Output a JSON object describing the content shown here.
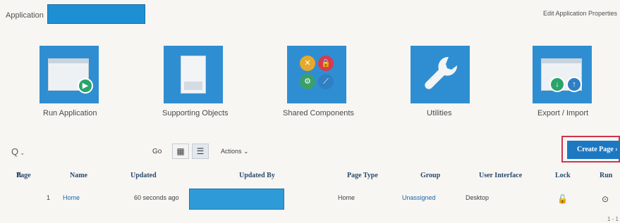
{
  "header": {
    "app_label": "Application",
    "edit_properties": "Edit Application Properties"
  },
  "tiles": [
    {
      "label": "Run Application"
    },
    {
      "label": "Supporting Objects"
    },
    {
      "label": "Shared Components"
    },
    {
      "label": "Utilities"
    },
    {
      "label": "Export / Import"
    }
  ],
  "toolbar": {
    "search_glyph": "Q",
    "go_label": "Go",
    "actions_label": "Actions",
    "create_page_label": "Create Page"
  },
  "table": {
    "columns": [
      "Page",
      "Name",
      "Updated",
      "Updated By",
      "Page Type",
      "Group",
      "User Interface",
      "Lock",
      "Run"
    ],
    "rows": [
      {
        "page": "1",
        "name": "Home",
        "updated": "60 seconds ago",
        "page_type": "Home",
        "group": "Unassigned",
        "ui": "Desktop"
      }
    ],
    "pagination": "1 - 1"
  },
  "colors": {
    "accent": "#2f8ed2",
    "button": "#1d78c2",
    "highlight": "#d4324d"
  }
}
